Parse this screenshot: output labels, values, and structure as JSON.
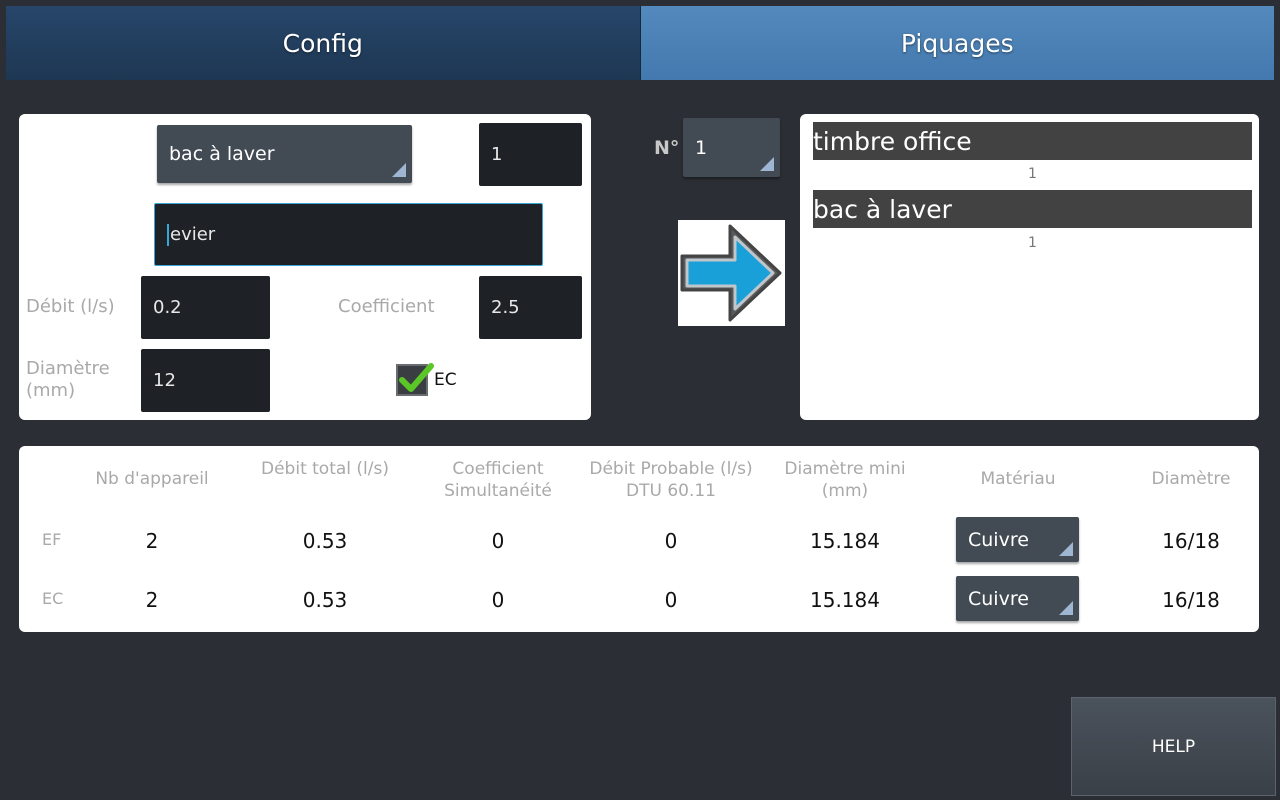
{
  "tabs": {
    "config": "Config",
    "piquages": "Piquages"
  },
  "form": {
    "appliance_select": "bac à laver",
    "quantity": "1",
    "name_input": "evier",
    "debit_label": "Débit (l/s)",
    "debit_value": "0.2",
    "coef_label": "Coefficient",
    "coef_value": "2.5",
    "diam_label": "Diamètre (mm)",
    "diam_value": "12",
    "ec_label": "EC",
    "ec_checked": true
  },
  "number": {
    "label": "N°",
    "value": "1"
  },
  "list": [
    {
      "name": "timbre office",
      "count": "1"
    },
    {
      "name": "bac à laver",
      "count": "1"
    }
  ],
  "results": {
    "headers": [
      "Nb d'appareil",
      "Débit total (l/s)",
      "Coefficient Simultanéité",
      "Débit Probable (l/s) DTU 60.11",
      "Diamètre mini (mm)",
      "Matériau",
      "Diamètre"
    ],
    "rows": [
      {
        "label": "EF",
        "nb": "2",
        "debit_total": "0.53",
        "coef": "0",
        "debit_probable": "0",
        "diam_mini": "15.184",
        "materiau": "Cuivre",
        "diametre": "16/18"
      },
      {
        "label": "EC",
        "nb": "2",
        "debit_total": "0.53",
        "coef": "0",
        "debit_probable": "0",
        "diam_mini": "15.184",
        "materiau": "Cuivre",
        "diametre": "16/18"
      }
    ]
  },
  "help": "HELP",
  "colors": {
    "accent": "#3aa6d6",
    "tab_active": "#4a7fb3",
    "tab_inactive": "#24405f",
    "arrow": "#1aa0d8"
  }
}
